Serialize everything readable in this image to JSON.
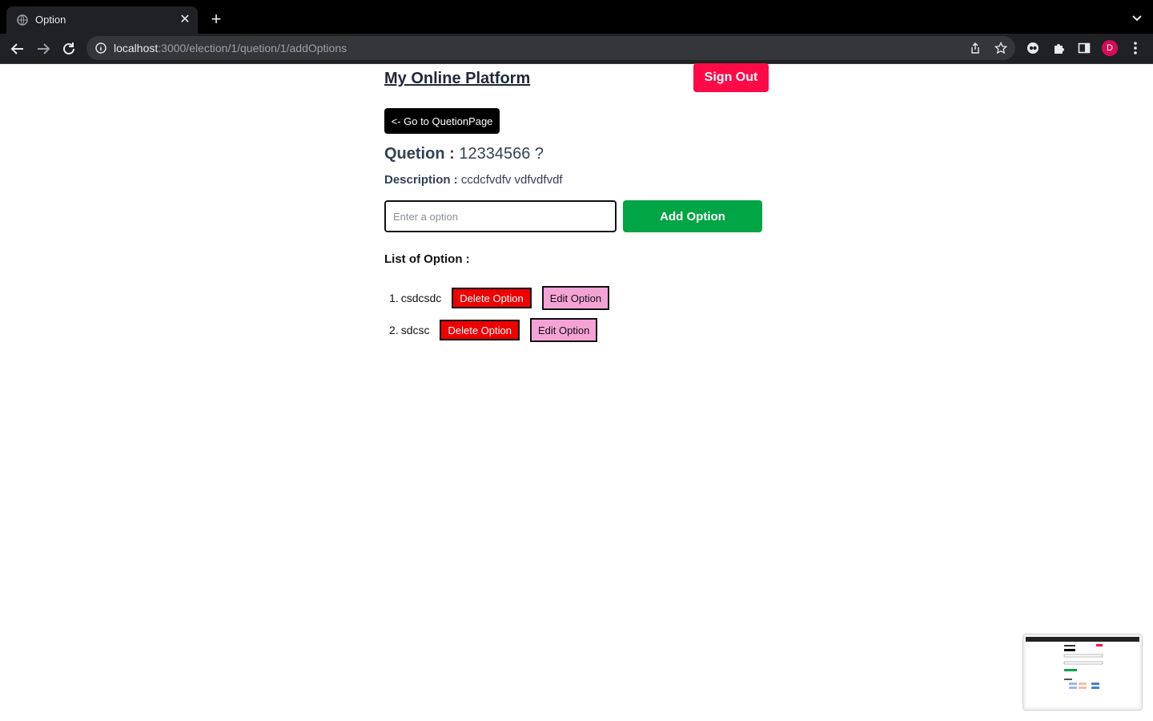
{
  "browser": {
    "tab_title": "Option",
    "url_host": "localhost",
    "url_rest": ":3000/election/1/quetion/1/addOptions",
    "profile_initial": "D"
  },
  "header": {
    "brand": "My Online Platform",
    "signout_label": "Sign Out"
  },
  "nav": {
    "back_label": "<- Go to QuetionPage"
  },
  "question": {
    "label": "Quetion : ",
    "text": "12334566 ?",
    "desc_label": "Description : ",
    "desc_text": "ccdcfvdfv vdfvdfvdf"
  },
  "add_form": {
    "placeholder": "Enter a option",
    "value": "",
    "button_label": "Add Option"
  },
  "options": {
    "heading": "List of Option :",
    "items": [
      {
        "num": "1.",
        "text": "csdcsdc",
        "delete_label": "Delete Option",
        "edit_label": "Edit Option"
      },
      {
        "num": "2.",
        "text": "sdcsc",
        "delete_label": "Delete Option",
        "edit_label": "Edit Option"
      }
    ]
  },
  "colors": {
    "signout": "#ff0a47",
    "add_option": "#00a545",
    "delete_option": "#ee0000",
    "edit_option": "#f5a3d6"
  }
}
